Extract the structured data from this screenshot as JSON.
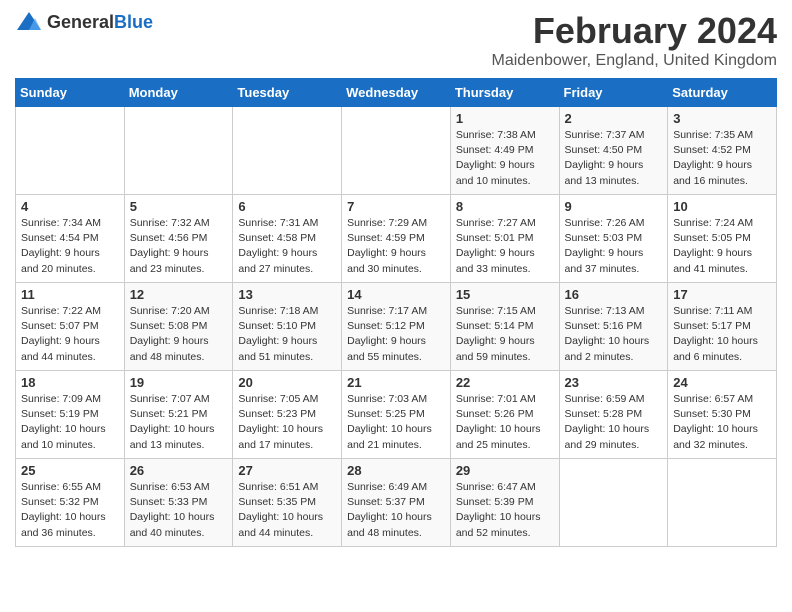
{
  "header": {
    "logo_general": "General",
    "logo_blue": "Blue",
    "month_title": "February 2024",
    "location": "Maidenbower, England, United Kingdom"
  },
  "days_of_week": [
    "Sunday",
    "Monday",
    "Tuesday",
    "Wednesday",
    "Thursday",
    "Friday",
    "Saturday"
  ],
  "weeks": [
    [
      {
        "day": "",
        "sunrise": "",
        "sunset": "",
        "daylight": ""
      },
      {
        "day": "",
        "sunrise": "",
        "sunset": "",
        "daylight": ""
      },
      {
        "day": "",
        "sunrise": "",
        "sunset": "",
        "daylight": ""
      },
      {
        "day": "",
        "sunrise": "",
        "sunset": "",
        "daylight": ""
      },
      {
        "day": "1",
        "sunrise": "Sunrise: 7:38 AM",
        "sunset": "Sunset: 4:49 PM",
        "daylight": "Daylight: 9 hours and 10 minutes."
      },
      {
        "day": "2",
        "sunrise": "Sunrise: 7:37 AM",
        "sunset": "Sunset: 4:50 PM",
        "daylight": "Daylight: 9 hours and 13 minutes."
      },
      {
        "day": "3",
        "sunrise": "Sunrise: 7:35 AM",
        "sunset": "Sunset: 4:52 PM",
        "daylight": "Daylight: 9 hours and 16 minutes."
      }
    ],
    [
      {
        "day": "4",
        "sunrise": "Sunrise: 7:34 AM",
        "sunset": "Sunset: 4:54 PM",
        "daylight": "Daylight: 9 hours and 20 minutes."
      },
      {
        "day": "5",
        "sunrise": "Sunrise: 7:32 AM",
        "sunset": "Sunset: 4:56 PM",
        "daylight": "Daylight: 9 hours and 23 minutes."
      },
      {
        "day": "6",
        "sunrise": "Sunrise: 7:31 AM",
        "sunset": "Sunset: 4:58 PM",
        "daylight": "Daylight: 9 hours and 27 minutes."
      },
      {
        "day": "7",
        "sunrise": "Sunrise: 7:29 AM",
        "sunset": "Sunset: 4:59 PM",
        "daylight": "Daylight: 9 hours and 30 minutes."
      },
      {
        "day": "8",
        "sunrise": "Sunrise: 7:27 AM",
        "sunset": "Sunset: 5:01 PM",
        "daylight": "Daylight: 9 hours and 33 minutes."
      },
      {
        "day": "9",
        "sunrise": "Sunrise: 7:26 AM",
        "sunset": "Sunset: 5:03 PM",
        "daylight": "Daylight: 9 hours and 37 minutes."
      },
      {
        "day": "10",
        "sunrise": "Sunrise: 7:24 AM",
        "sunset": "Sunset: 5:05 PM",
        "daylight": "Daylight: 9 hours and 41 minutes."
      }
    ],
    [
      {
        "day": "11",
        "sunrise": "Sunrise: 7:22 AM",
        "sunset": "Sunset: 5:07 PM",
        "daylight": "Daylight: 9 hours and 44 minutes."
      },
      {
        "day": "12",
        "sunrise": "Sunrise: 7:20 AM",
        "sunset": "Sunset: 5:08 PM",
        "daylight": "Daylight: 9 hours and 48 minutes."
      },
      {
        "day": "13",
        "sunrise": "Sunrise: 7:18 AM",
        "sunset": "Sunset: 5:10 PM",
        "daylight": "Daylight: 9 hours and 51 minutes."
      },
      {
        "day": "14",
        "sunrise": "Sunrise: 7:17 AM",
        "sunset": "Sunset: 5:12 PM",
        "daylight": "Daylight: 9 hours and 55 minutes."
      },
      {
        "day": "15",
        "sunrise": "Sunrise: 7:15 AM",
        "sunset": "Sunset: 5:14 PM",
        "daylight": "Daylight: 9 hours and 59 minutes."
      },
      {
        "day": "16",
        "sunrise": "Sunrise: 7:13 AM",
        "sunset": "Sunset: 5:16 PM",
        "daylight": "Daylight: 10 hours and 2 minutes."
      },
      {
        "day": "17",
        "sunrise": "Sunrise: 7:11 AM",
        "sunset": "Sunset: 5:17 PM",
        "daylight": "Daylight: 10 hours and 6 minutes."
      }
    ],
    [
      {
        "day": "18",
        "sunrise": "Sunrise: 7:09 AM",
        "sunset": "Sunset: 5:19 PM",
        "daylight": "Daylight: 10 hours and 10 minutes."
      },
      {
        "day": "19",
        "sunrise": "Sunrise: 7:07 AM",
        "sunset": "Sunset: 5:21 PM",
        "daylight": "Daylight: 10 hours and 13 minutes."
      },
      {
        "day": "20",
        "sunrise": "Sunrise: 7:05 AM",
        "sunset": "Sunset: 5:23 PM",
        "daylight": "Daylight: 10 hours and 17 minutes."
      },
      {
        "day": "21",
        "sunrise": "Sunrise: 7:03 AM",
        "sunset": "Sunset: 5:25 PM",
        "daylight": "Daylight: 10 hours and 21 minutes."
      },
      {
        "day": "22",
        "sunrise": "Sunrise: 7:01 AM",
        "sunset": "Sunset: 5:26 PM",
        "daylight": "Daylight: 10 hours and 25 minutes."
      },
      {
        "day": "23",
        "sunrise": "Sunrise: 6:59 AM",
        "sunset": "Sunset: 5:28 PM",
        "daylight": "Daylight: 10 hours and 29 minutes."
      },
      {
        "day": "24",
        "sunrise": "Sunrise: 6:57 AM",
        "sunset": "Sunset: 5:30 PM",
        "daylight": "Daylight: 10 hours and 32 minutes."
      }
    ],
    [
      {
        "day": "25",
        "sunrise": "Sunrise: 6:55 AM",
        "sunset": "Sunset: 5:32 PM",
        "daylight": "Daylight: 10 hours and 36 minutes."
      },
      {
        "day": "26",
        "sunrise": "Sunrise: 6:53 AM",
        "sunset": "Sunset: 5:33 PM",
        "daylight": "Daylight: 10 hours and 40 minutes."
      },
      {
        "day": "27",
        "sunrise": "Sunrise: 6:51 AM",
        "sunset": "Sunset: 5:35 PM",
        "daylight": "Daylight: 10 hours and 44 minutes."
      },
      {
        "day": "28",
        "sunrise": "Sunrise: 6:49 AM",
        "sunset": "Sunset: 5:37 PM",
        "daylight": "Daylight: 10 hours and 48 minutes."
      },
      {
        "day": "29",
        "sunrise": "Sunrise: 6:47 AM",
        "sunset": "Sunset: 5:39 PM",
        "daylight": "Daylight: 10 hours and 52 minutes."
      },
      {
        "day": "",
        "sunrise": "",
        "sunset": "",
        "daylight": ""
      },
      {
        "day": "",
        "sunrise": "",
        "sunset": "",
        "daylight": ""
      }
    ]
  ]
}
